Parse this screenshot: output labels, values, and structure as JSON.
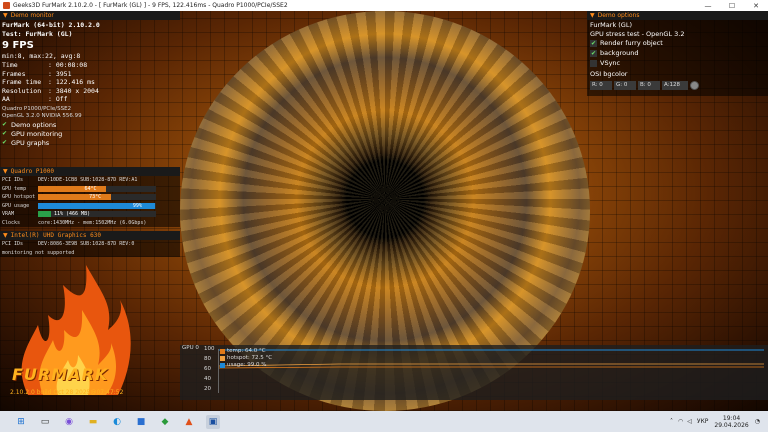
{
  "window": {
    "title": "Geeks3D FurMark 2.10.2.0 - [ FurMark (GL) ] - 9 FPS, 122.416ms - Quadro P1000/PCIe/SSE2",
    "minimize": "—",
    "maximize": "☐",
    "close": "✕"
  },
  "demo_monitor": {
    "header": "Demo monitor",
    "line1": "FurMark (64-bit) 2.10.2.0",
    "line2": "Test: FurMark (GL)",
    "fps": "9 FPS",
    "minmax": "min:8, max:22, avg:8",
    "stats": [
      {
        "k": "Time",
        "v": ": 00:08:08"
      },
      {
        "k": "Frames",
        "v": ": 3951"
      },
      {
        "k": "Frame time",
        "v": ": 122.416 ms"
      },
      {
        "k": "Resolution",
        "v": ": 3840 x 2004"
      },
      {
        "k": "AA",
        "v": ": Off"
      }
    ],
    "renderer": "Quadro P1000/PCIe/SSE2",
    "gl": "OpenGL 3.2.0 NVIDIA 556.99",
    "options": [
      {
        "label": "Demo options",
        "checked": true
      },
      {
        "label": "GPU monitoring",
        "checked": true
      },
      {
        "label": "GPU graphs",
        "checked": true
      }
    ]
  },
  "gpu0": {
    "header": "Quadro P1000",
    "pci_k": "PCI IDs",
    "pci_v": "DEV:10DE-1CB8 SUB:1028-87D REV:A1",
    "rows": [
      {
        "k": "GPU temp",
        "v": "64°C",
        "fill": 0.58,
        "color": "#e07a1a"
      },
      {
        "k": "GPU hotspot",
        "v": "73°C",
        "fill": 0.62,
        "color": "#e07a1a"
      },
      {
        "k": "GPU usage",
        "v": "99%",
        "fill": 0.99,
        "color": "#1e8ad8"
      },
      {
        "k": "VRAM",
        "v": "11% (466 MB)",
        "fill": 0.11,
        "color": "#2aa04a"
      }
    ],
    "clocks_k": "Clocks",
    "clocks_v": "core:1430MHz - mem:1502MHz (6.0Gbps)"
  },
  "gpu1": {
    "header": "Intel(R) UHD Graphics 630",
    "pci_k": "PCI IDs",
    "pci_v": "DEV:8086-3E9B SUB:1028-87D REV:0",
    "note": "monitoring not supported"
  },
  "logo": {
    "text": "FURMARK",
    "build": "2.10.2.0 build Oct 28 2025@07:47:52"
  },
  "demo_options": {
    "header": "Demo options",
    "line1": "FurMark (GL)",
    "line2": "GPU stress test - OpenGL 3.2",
    "checks": [
      {
        "label": "Render furry object",
        "checked": true
      },
      {
        "label": "background",
        "checked": true
      },
      {
        "label": "VSync",
        "checked": false
      }
    ],
    "osi_label": "OSI bgcolor",
    "fields": [
      "R: 0",
      "G: 0",
      "B: 0",
      "A:128"
    ]
  },
  "graph": {
    "label": "GPU 0",
    "y_ticks": [
      "100",
      "80",
      "60",
      "40",
      "20"
    ],
    "legend": [
      {
        "label": "temp: 64.0 °C",
        "color": "#e07a1a"
      },
      {
        "label": "hotspot: 72.5 °C",
        "color": "#f0a040"
      },
      {
        "label": "usage: 99.0 %",
        "color": "#1e8ad8"
      }
    ]
  },
  "taskbar": {
    "lang": "УКР",
    "time": "19:04",
    "date": "29.04.2026",
    "icons": [
      "windows-start-icon",
      "task-view-icon",
      "copilot-icon",
      "file-explorer-icon",
      "edge-icon",
      "store-icon",
      "gpu-tool-icon",
      "furmark-icon",
      "active-app-icon"
    ]
  }
}
